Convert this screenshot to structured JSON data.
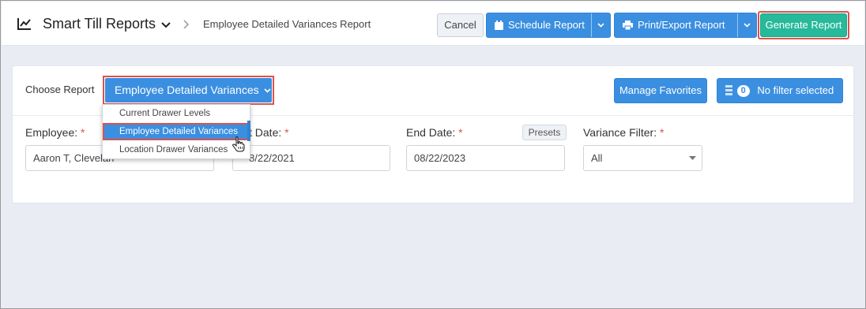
{
  "header": {
    "app_title": "Smart Till Reports",
    "app_icon": "line-chart-icon",
    "breadcrumb_current": "Employee Detailed Variances Report",
    "cancel_label": "Cancel",
    "schedule_label": "Schedule Report",
    "print_label": "Print/Export Report",
    "generate_label": "Generate Report"
  },
  "colors": {
    "primary_blue": "#3b8fe0",
    "generate_green": "#26b99a",
    "highlight_red": "#d9534f",
    "required_red": "#d9534f"
  },
  "report_picker": {
    "label": "Choose Report",
    "selected": "Employee Detailed Variances",
    "options": [
      {
        "label": "Current Drawer Levels",
        "active": false
      },
      {
        "label": "Employee Detailed Variances",
        "active": true
      },
      {
        "label": "Location Drawer Variances",
        "active": false
      }
    ]
  },
  "favorites_label": "Manage Favorites",
  "filter": {
    "count": "0",
    "label": "No filter selected"
  },
  "fields": {
    "employee": {
      "label": "Employee:",
      "required": "*",
      "value": "Aaron T, Clevelan"
    },
    "start_date": {
      "label": "t Date:",
      "required": "*",
      "value": "8/22/2021"
    },
    "end_date": {
      "label": "End Date:",
      "required": "*",
      "value": "08/22/2023",
      "presets_label": "Presets"
    },
    "variance_filter": {
      "label": "Variance Filter:",
      "required": "*",
      "value": "All"
    }
  }
}
